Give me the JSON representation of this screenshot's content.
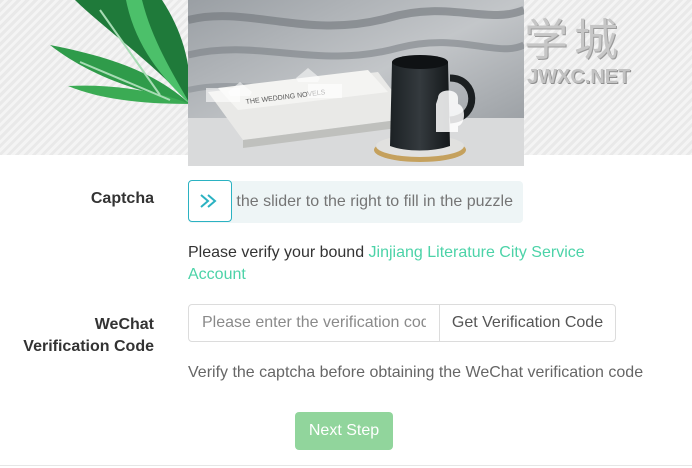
{
  "logo": {
    "text": "学城",
    "subtext": "JWXC.NET"
  },
  "captcha": {
    "label": "Captcha",
    "slider_hint": "Drag the slider to the right to fill in the puzzle",
    "refresh_icon": "refresh-icon",
    "handle_icon": "double-chevron-right-icon"
  },
  "verify_note": {
    "prefix": "Please verify your bound ",
    "link": "Jinjiang Literature City Service Account"
  },
  "wechat": {
    "label_line1": "WeChat",
    "label_line2": "Verification Code",
    "input_placeholder": "Please enter the verification code",
    "input_value": "",
    "get_code_label": "Get Verification Code",
    "help": "Verify the captcha before obtaining the WeChat verification code"
  },
  "next_button": "Next Step",
  "colors": {
    "accent_teal": "#2bb2c2",
    "link_green": "#4cd3a8",
    "button_green": "#91d59c"
  }
}
